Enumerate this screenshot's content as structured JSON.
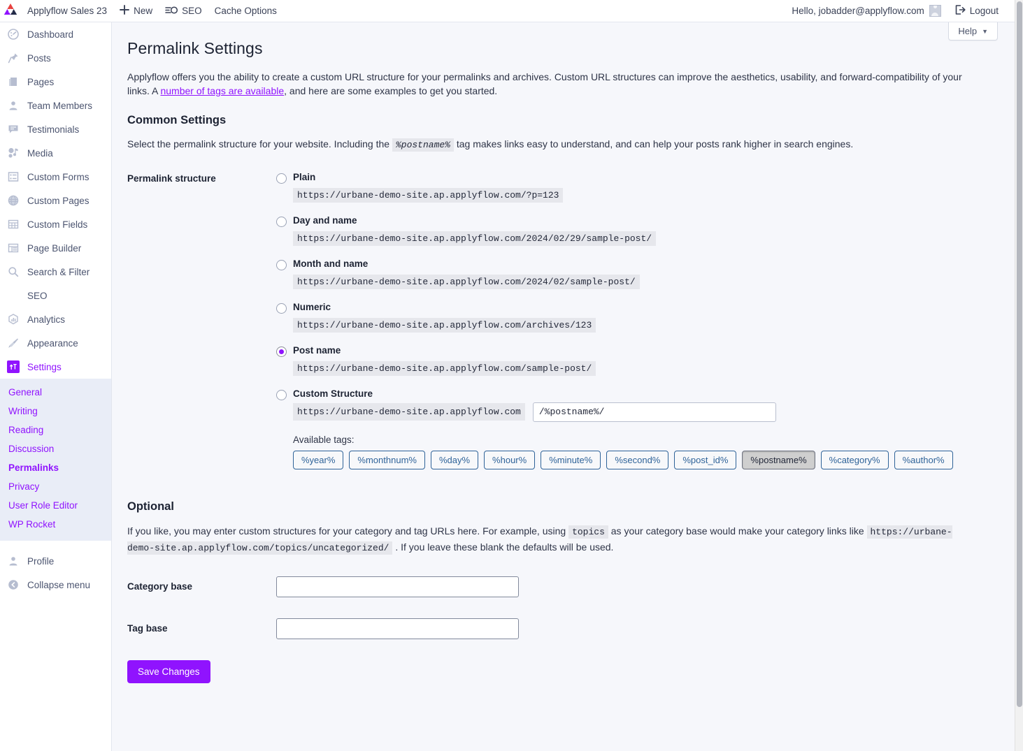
{
  "adminbar": {
    "logo_name": "applyflow-logo",
    "site_title": "Applyflow Sales 23",
    "new_label": "New",
    "seo_label": "SEO",
    "cache_label": "Cache Options",
    "greeting": "Hello, jobadder@applyflow.com",
    "logout_label": "Logout"
  },
  "help": {
    "label": "Help",
    "caret": "▼"
  },
  "sidebar": {
    "items": [
      {
        "label": "Dashboard",
        "icon": "dashboard-icon"
      },
      {
        "label": "Posts",
        "icon": "pin-icon"
      },
      {
        "label": "Pages",
        "icon": "page-icon"
      },
      {
        "label": "Team Members",
        "icon": "user-icon"
      },
      {
        "label": "Testimonials",
        "icon": "speech-bubble-icon"
      },
      {
        "label": "Media",
        "icon": "media-icon"
      },
      {
        "label": "Custom Forms",
        "icon": "list-icon"
      },
      {
        "label": "Custom Pages",
        "icon": "globe-icon"
      },
      {
        "label": "Custom Fields",
        "icon": "table-icon"
      },
      {
        "label": "Page Builder",
        "icon": "layout-icon"
      },
      {
        "label": "Search & Filter",
        "icon": "search-icon"
      },
      {
        "label": "SEO",
        "icon": "none"
      },
      {
        "label": "Analytics",
        "icon": "chart-icon"
      },
      {
        "label": "Appearance",
        "icon": "brush-icon"
      },
      {
        "label": "Settings",
        "icon": "settings-icon",
        "active": true
      }
    ],
    "submenu": [
      {
        "label": "General"
      },
      {
        "label": "Writing"
      },
      {
        "label": "Reading"
      },
      {
        "label": "Discussion"
      },
      {
        "label": "Permalinks",
        "current": true
      },
      {
        "label": "Privacy"
      },
      {
        "label": "User Role Editor"
      },
      {
        "label": "WP Rocket"
      }
    ],
    "footer": [
      {
        "label": "Profile",
        "icon": "profile-icon"
      },
      {
        "label": "Collapse menu",
        "icon": "collapse-icon"
      }
    ]
  },
  "main": {
    "page_title": "Permalink Settings",
    "intro_part1": "Applyflow offers you the ability to create a custom URL structure for your permalinks and archives. Custom URL structures can improve the aesthetics, usability, and forward-compatibility of your links. A ",
    "intro_link": "number of tags are available",
    "intro_part2": ", and here are some examples to get you started.",
    "common_settings_heading": "Common Settings",
    "common_desc_part1": "Select the permalink structure for your website. Including the ",
    "common_desc_code": "%postname%",
    "common_desc_part2": " tag makes links easy to understand, and can help your posts rank higher in search engines.",
    "permalink_structure_label": "Permalink structure",
    "options": [
      {
        "label": "Plain",
        "url": "https://urbane-demo-site.ap.applyflow.com/?p=123",
        "selected": false
      },
      {
        "label": "Day and name",
        "url": "https://urbane-demo-site.ap.applyflow.com/2024/02/29/sample-post/",
        "selected": false
      },
      {
        "label": "Month and name",
        "url": "https://urbane-demo-site.ap.applyflow.com/2024/02/sample-post/",
        "selected": false
      },
      {
        "label": "Numeric",
        "url": "https://urbane-demo-site.ap.applyflow.com/archives/123",
        "selected": false
      },
      {
        "label": "Post name",
        "url": "https://urbane-demo-site.ap.applyflow.com/sample-post/",
        "selected": true
      }
    ],
    "custom_structure": {
      "label": "Custom Structure",
      "selected": false,
      "prefix": "https://urbane-demo-site.ap.applyflow.com",
      "value": "/%postname%/"
    },
    "available_tags_label": "Available tags:",
    "tags": [
      {
        "label": "%year%",
        "pressed": false
      },
      {
        "label": "%monthnum%",
        "pressed": false
      },
      {
        "label": "%day%",
        "pressed": false
      },
      {
        "label": "%hour%",
        "pressed": false
      },
      {
        "label": "%minute%",
        "pressed": false
      },
      {
        "label": "%second%",
        "pressed": false
      },
      {
        "label": "%post_id%",
        "pressed": false
      },
      {
        "label": "%postname%",
        "pressed": true
      },
      {
        "label": "%category%",
        "pressed": false
      },
      {
        "label": "%author%",
        "pressed": false
      }
    ],
    "optional_heading": "Optional",
    "optional_part1": "If you like, you may enter custom structures for your category and tag URLs here. For example, using ",
    "optional_code1": "topics",
    "optional_part2": " as your category base would make your category links like ",
    "optional_code2": "https://urbane-demo-site.ap.applyflow.com/topics/uncategorized/",
    "optional_part3": " . If you leave these blank the defaults will be used.",
    "category_base_label": "Category base",
    "category_base_value": "",
    "tag_base_label": "Tag base",
    "tag_base_value": "",
    "save_label": "Save Changes"
  },
  "colors": {
    "accent_purple": "#9013fe",
    "tag_blue": "#2f6399",
    "sidebar_submenu_bg": "#e9edf7",
    "page_bg": "#f6f7fb"
  }
}
